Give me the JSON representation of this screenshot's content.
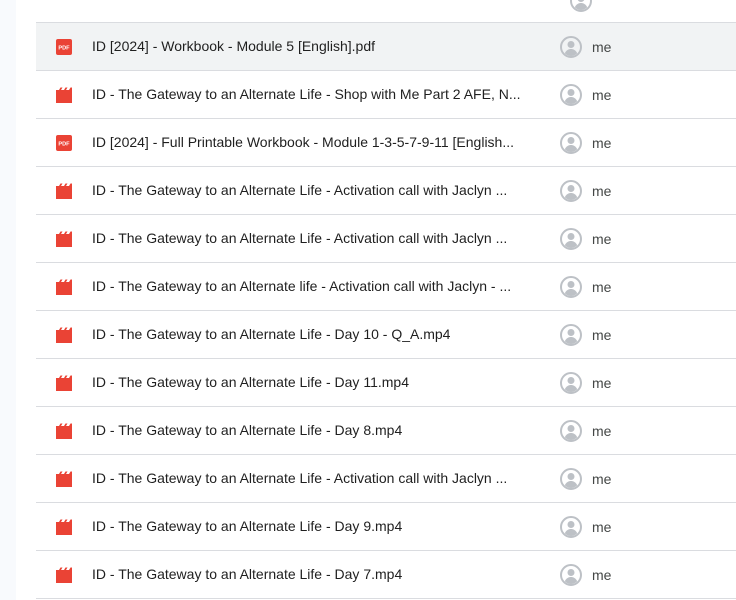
{
  "colors": {
    "pdf_icon": "#ea4335",
    "video_icon": "#ea4335",
    "avatar": "#bdc1c6",
    "divider": "#dadce0",
    "selected_row": "#f1f3f4"
  },
  "files": [
    {
      "name": "ID [2024] - Workbook - Module 5 [English].pdf",
      "type": "pdf",
      "icon": "pdf-icon",
      "icon_text": "PDF",
      "owner": "me",
      "selected": true
    },
    {
      "name": "ID - The Gateway to an Alternate Life - Shop with Me Part 2 AFE, N...",
      "type": "video",
      "icon": "video-icon",
      "owner": "me",
      "selected": false
    },
    {
      "name": "ID [2024] - Full Printable Workbook - Module 1-3-5-7-9-11 [English...",
      "type": "pdf",
      "icon": "pdf-icon",
      "icon_text": "PDF",
      "owner": "me",
      "selected": false
    },
    {
      "name": "ID - The Gateway to an Alternate Life - Activation call with Jaclyn ...",
      "type": "video",
      "icon": "video-icon",
      "owner": "me",
      "selected": false
    },
    {
      "name": "ID - The Gateway to an Alternate Life - Activation call with Jaclyn ...",
      "type": "video",
      "icon": "video-icon",
      "owner": "me",
      "selected": false
    },
    {
      "name": "ID - The Gateway to an Alternate life - Activation call with Jaclyn - ...",
      "type": "video",
      "icon": "video-icon",
      "owner": "me",
      "selected": false
    },
    {
      "name": "ID - The Gateway to an Alternate Life - Day 10 - Q_A.mp4",
      "type": "video",
      "icon": "video-icon",
      "owner": "me",
      "selected": false
    },
    {
      "name": "ID - The Gateway to an Alternate Life - Day 11.mp4",
      "type": "video",
      "icon": "video-icon",
      "owner": "me",
      "selected": false
    },
    {
      "name": "ID - The Gateway to an Alternate Life - Day 8.mp4",
      "type": "video",
      "icon": "video-icon",
      "owner": "me",
      "selected": false
    },
    {
      "name": "ID - The Gateway to an Alternate Life - Activation call with Jaclyn ...",
      "type": "video",
      "icon": "video-icon",
      "owner": "me",
      "selected": false
    },
    {
      "name": "ID - The Gateway to an Alternate Life - Day 9.mp4",
      "type": "video",
      "icon": "video-icon",
      "owner": "me",
      "selected": false
    },
    {
      "name": "ID - The Gateway to an Alternate Life - Day 7.mp4",
      "type": "video",
      "icon": "video-icon",
      "owner": "me",
      "selected": false
    }
  ]
}
